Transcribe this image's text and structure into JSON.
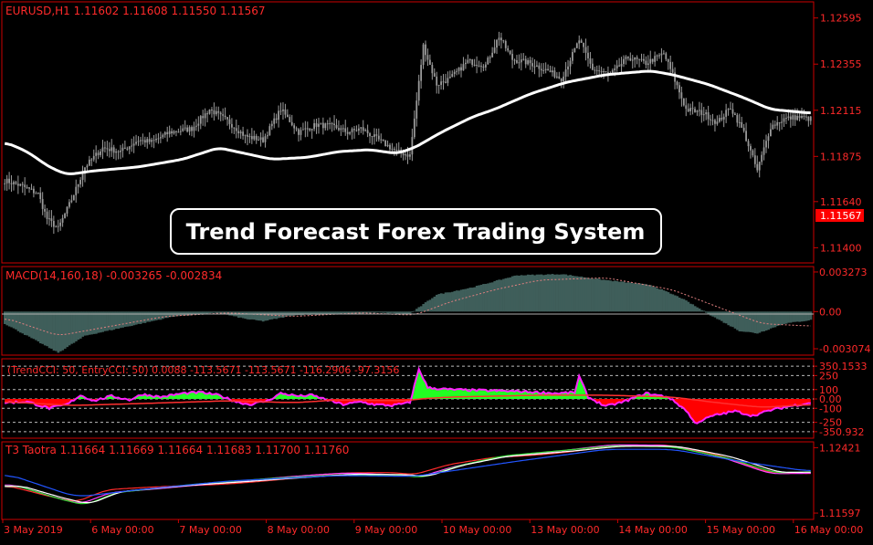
{
  "colors": {
    "background": "#000000",
    "frame": "#cc0000",
    "axis_text": "#ff2a2a",
    "header_text": "#ff2a2a",
    "candles": "#9a9a9a",
    "ma_line": "#ffffff",
    "macd_hist": "#3f5e5a",
    "macd_signal": "#e08080",
    "cci_pos": "#22ff22",
    "cci_neg": "#ff0000",
    "cci_line": "#ff22ff",
    "cci_red_line": "#ff3030",
    "t3_colors": [
      "#ff2a2a",
      "#ff44ff",
      "#33dd33",
      "#ffffff",
      "#2255ff"
    ],
    "price_tag_bg": "#ff0000",
    "banner_border": "#ffffff",
    "banner_text": "#ffffff"
  },
  "banner": {
    "title": "Trend Forecast Forex Trading System"
  },
  "panels": {
    "price": {
      "header": "EURUSD,H1  1.11602 1.11608 1.11550 1.11567",
      "current_price": "1.11567"
    },
    "macd": {
      "header": "MACD(14,160,18) -0.003265 -0.002834"
    },
    "cci": {
      "header": "(TrendCCI: 50, EntryCCI: 50)  0.0088  -113.5671  -113.5671  -116.2906  -97.3156"
    },
    "t3": {
      "header": "T3 Taotra 1.11664 1.11669 1.11664 1.11683 1.11700 1.11760"
    }
  },
  "x_axis": {
    "labels": [
      "3 May 2019",
      "6 May 00:00",
      "7 May 00:00",
      "8 May 00:00",
      "9 May 00:00",
      "10 May 00:00",
      "13 May 00:00",
      "14 May 00:00",
      "15 May 00:00",
      "16 May 00:00"
    ]
  },
  "chart_data": [
    {
      "type": "candlestick",
      "name": "price",
      "y_ticks": [
        "1.12595",
        "1.12355",
        "1.12115",
        "1.11875",
        "1.11640",
        "1.11400"
      ],
      "ylim": [
        1.1134,
        1.1266
      ],
      "close_keys": [
        [
          0,
          1.1175
        ],
        [
          8,
          1.1172
        ],
        [
          15,
          1.1168
        ],
        [
          19,
          1.1155
        ],
        [
          24,
          1.115
        ],
        [
          30,
          1.1165
        ],
        [
          36,
          1.1182
        ],
        [
          44,
          1.1192
        ],
        [
          52,
          1.119
        ],
        [
          60,
          1.1196
        ],
        [
          66,
          1.1195
        ],
        [
          74,
          1.12
        ],
        [
          84,
          1.1202
        ],
        [
          92,
          1.1212
        ],
        [
          100,
          1.1206
        ],
        [
          108,
          1.1198
        ],
        [
          116,
          1.1196
        ],
        [
          124,
          1.1212
        ],
        [
          132,
          1.12
        ],
        [
          140,
          1.1204
        ],
        [
          148,
          1.1203
        ],
        [
          154,
          1.12
        ],
        [
          160,
          1.1202
        ],
        [
          168,
          1.1196
        ],
        [
          176,
          1.119
        ],
        [
          182,
          1.1188
        ],
        [
          188,
          1.1245
        ],
        [
          194,
          1.1225
        ],
        [
          200,
          1.1228
        ],
        [
          208,
          1.1237
        ],
        [
          216,
          1.1235
        ],
        [
          222,
          1.125
        ],
        [
          228,
          1.1238
        ],
        [
          236,
          1.1236
        ],
        [
          244,
          1.1232
        ],
        [
          250,
          1.1228
        ],
        [
          258,
          1.1248
        ],
        [
          264,
          1.1233
        ],
        [
          272,
          1.123
        ],
        [
          280,
          1.1239
        ],
        [
          288,
          1.1236
        ],
        [
          296,
          1.1241
        ],
        [
          300,
          1.123
        ],
        [
          306,
          1.1212
        ],
        [
          314,
          1.121
        ],
        [
          320,
          1.1205
        ],
        [
          326,
          1.1213
        ],
        [
          332,
          1.12
        ],
        [
          338,
          1.118
        ],
        [
          344,
          1.1203
        ],
        [
          350,
          1.1207
        ],
        [
          356,
          1.1208
        ],
        [
          362,
          1.1207
        ]
      ],
      "ma_keys": [
        [
          0,
          1.1195
        ],
        [
          10,
          1.119
        ],
        [
          20,
          1.1182
        ],
        [
          28,
          1.1178
        ],
        [
          40,
          1.118
        ],
        [
          60,
          1.1182
        ],
        [
          80,
          1.1186
        ],
        [
          96,
          1.1192
        ],
        [
          104,
          1.119
        ],
        [
          112,
          1.1188
        ],
        [
          120,
          1.1186
        ],
        [
          136,
          1.1187
        ],
        [
          150,
          1.119
        ],
        [
          164,
          1.1191
        ],
        [
          176,
          1.1189
        ],
        [
          184,
          1.1192
        ],
        [
          196,
          1.12
        ],
        [
          210,
          1.1208
        ],
        [
          220,
          1.1212
        ],
        [
          236,
          1.122
        ],
        [
          252,
          1.1226
        ],
        [
          270,
          1.123
        ],
        [
          290,
          1.1232
        ],
        [
          300,
          1.123
        ],
        [
          316,
          1.1225
        ],
        [
          332,
          1.1218
        ],
        [
          344,
          1.1212
        ],
        [
          362,
          1.121
        ]
      ]
    },
    {
      "type": "histogram",
      "name": "MACD",
      "y_ticks": [
        "0.003273",
        "0.00",
        "-0.003074"
      ],
      "ylim": [
        -0.00345,
        0.00342
      ],
      "hist_keys": [
        [
          0,
          -0.001
        ],
        [
          12,
          -0.0022
        ],
        [
          24,
          -0.0034
        ],
        [
          36,
          -0.002
        ],
        [
          56,
          -0.0012
        ],
        [
          76,
          -0.0004
        ],
        [
          96,
          -0.0001
        ],
        [
          108,
          -0.0006
        ],
        [
          116,
          -0.0008
        ],
        [
          130,
          -0.0003
        ],
        [
          148,
          -0.0002
        ],
        [
          168,
          -0.0001
        ],
        [
          182,
          -0.0002
        ],
        [
          194,
          0.0014
        ],
        [
          210,
          0.002
        ],
        [
          230,
          0.003
        ],
        [
          250,
          0.0031
        ],
        [
          270,
          0.0026
        ],
        [
          290,
          0.0022
        ],
        [
          304,
          0.0011
        ],
        [
          318,
          -0.0004
        ],
        [
          330,
          -0.0016
        ],
        [
          338,
          -0.0018
        ],
        [
          350,
          -0.001
        ],
        [
          362,
          -0.0007
        ]
      ],
      "signal_keys": [
        [
          0,
          -0.0005
        ],
        [
          24,
          -0.002
        ],
        [
          48,
          -0.0012
        ],
        [
          72,
          -0.0004
        ],
        [
          100,
          -0.0001
        ],
        [
          130,
          -0.0004
        ],
        [
          160,
          -0.0001
        ],
        [
          184,
          -0.0003
        ],
        [
          200,
          0.0008
        ],
        [
          220,
          0.0018
        ],
        [
          240,
          0.0026
        ],
        [
          270,
          0.0028
        ],
        [
          300,
          0.0018
        ],
        [
          320,
          0.0004
        ],
        [
          340,
          -0.001
        ],
        [
          362,
          -0.0012
        ]
      ]
    },
    {
      "type": "area",
      "name": "CCI",
      "y_ticks": [
        "350.1533",
        "250",
        "100",
        "0.00",
        "-100",
        "-250",
        "-350.932"
      ],
      "ylim": [
        -400,
        400
      ],
      "cci_keys": [
        [
          0,
          -40
        ],
        [
          10,
          -30
        ],
        [
          20,
          -100
        ],
        [
          28,
          -60
        ],
        [
          34,
          40
        ],
        [
          40,
          -20
        ],
        [
          48,
          30
        ],
        [
          56,
          -10
        ],
        [
          62,
          50
        ],
        [
          70,
          20
        ],
        [
          80,
          60
        ],
        [
          88,
          70
        ],
        [
          96,
          40
        ],
        [
          104,
          -30
        ],
        [
          110,
          -60
        ],
        [
          118,
          -20
        ],
        [
          124,
          60
        ],
        [
          132,
          30
        ],
        [
          138,
          40
        ],
        [
          146,
          -20
        ],
        [
          152,
          -60
        ],
        [
          160,
          -30
        ],
        [
          166,
          -60
        ],
        [
          174,
          -70
        ],
        [
          182,
          -40
        ],
        [
          186,
          320
        ],
        [
          190,
          120
        ],
        [
          200,
          100
        ],
        [
          216,
          90
        ],
        [
          232,
          80
        ],
        [
          248,
          60
        ],
        [
          256,
          70
        ],
        [
          258,
          240
        ],
        [
          262,
          20
        ],
        [
          270,
          -80
        ],
        [
          278,
          -30
        ],
        [
          288,
          60
        ],
        [
          298,
          20
        ],
        [
          306,
          -120
        ],
        [
          310,
          -260
        ],
        [
          318,
          -180
        ],
        [
          328,
          -130
        ],
        [
          336,
          -180
        ],
        [
          344,
          -120
        ],
        [
          352,
          -80
        ],
        [
          362,
          -40
        ]
      ],
      "red_keys": [
        [
          0,
          -30
        ],
        [
          30,
          -70
        ],
        [
          60,
          -50
        ],
        [
          100,
          -20
        ],
        [
          130,
          -40
        ],
        [
          150,
          -10
        ],
        [
          180,
          -20
        ],
        [
          186,
          0
        ],
        [
          200,
          20
        ],
        [
          240,
          40
        ],
        [
          270,
          40
        ],
        [
          300,
          20
        ],
        [
          320,
          -40
        ],
        [
          340,
          -90
        ],
        [
          362,
          -60
        ]
      ]
    },
    {
      "type": "line",
      "name": "T3 Taotra",
      "y_ticks": [
        "1.12421",
        "1.11597"
      ],
      "ylim": [
        1.1154,
        1.1246
      ],
      "t3_keys": [
        [
          0,
          1.1195
        ],
        [
          20,
          1.1178
        ],
        [
          32,
          1.117
        ],
        [
          46,
          1.1186
        ],
        [
          80,
          1.1196
        ],
        [
          116,
          1.1203
        ],
        [
          150,
          1.1208
        ],
        [
          176,
          1.1207
        ],
        [
          184,
          1.1205
        ],
        [
          200,
          1.122
        ],
        [
          220,
          1.1232
        ],
        [
          250,
          1.1239
        ],
        [
          270,
          1.1244
        ],
        [
          296,
          1.1243
        ],
        [
          320,
          1.123
        ],
        [
          342,
          1.1211
        ],
        [
          362,
          1.1212
        ]
      ],
      "blue_keys": [
        [
          0,
          1.121
        ],
        [
          32,
          1.118
        ],
        [
          60,
          1.1189
        ],
        [
          100,
          1.12
        ],
        [
          150,
          1.1207
        ],
        [
          184,
          1.1206
        ],
        [
          230,
          1.1225
        ],
        [
          270,
          1.124
        ],
        [
          300,
          1.124
        ],
        [
          330,
          1.1225
        ],
        [
          362,
          1.1212
        ]
      ]
    }
  ]
}
